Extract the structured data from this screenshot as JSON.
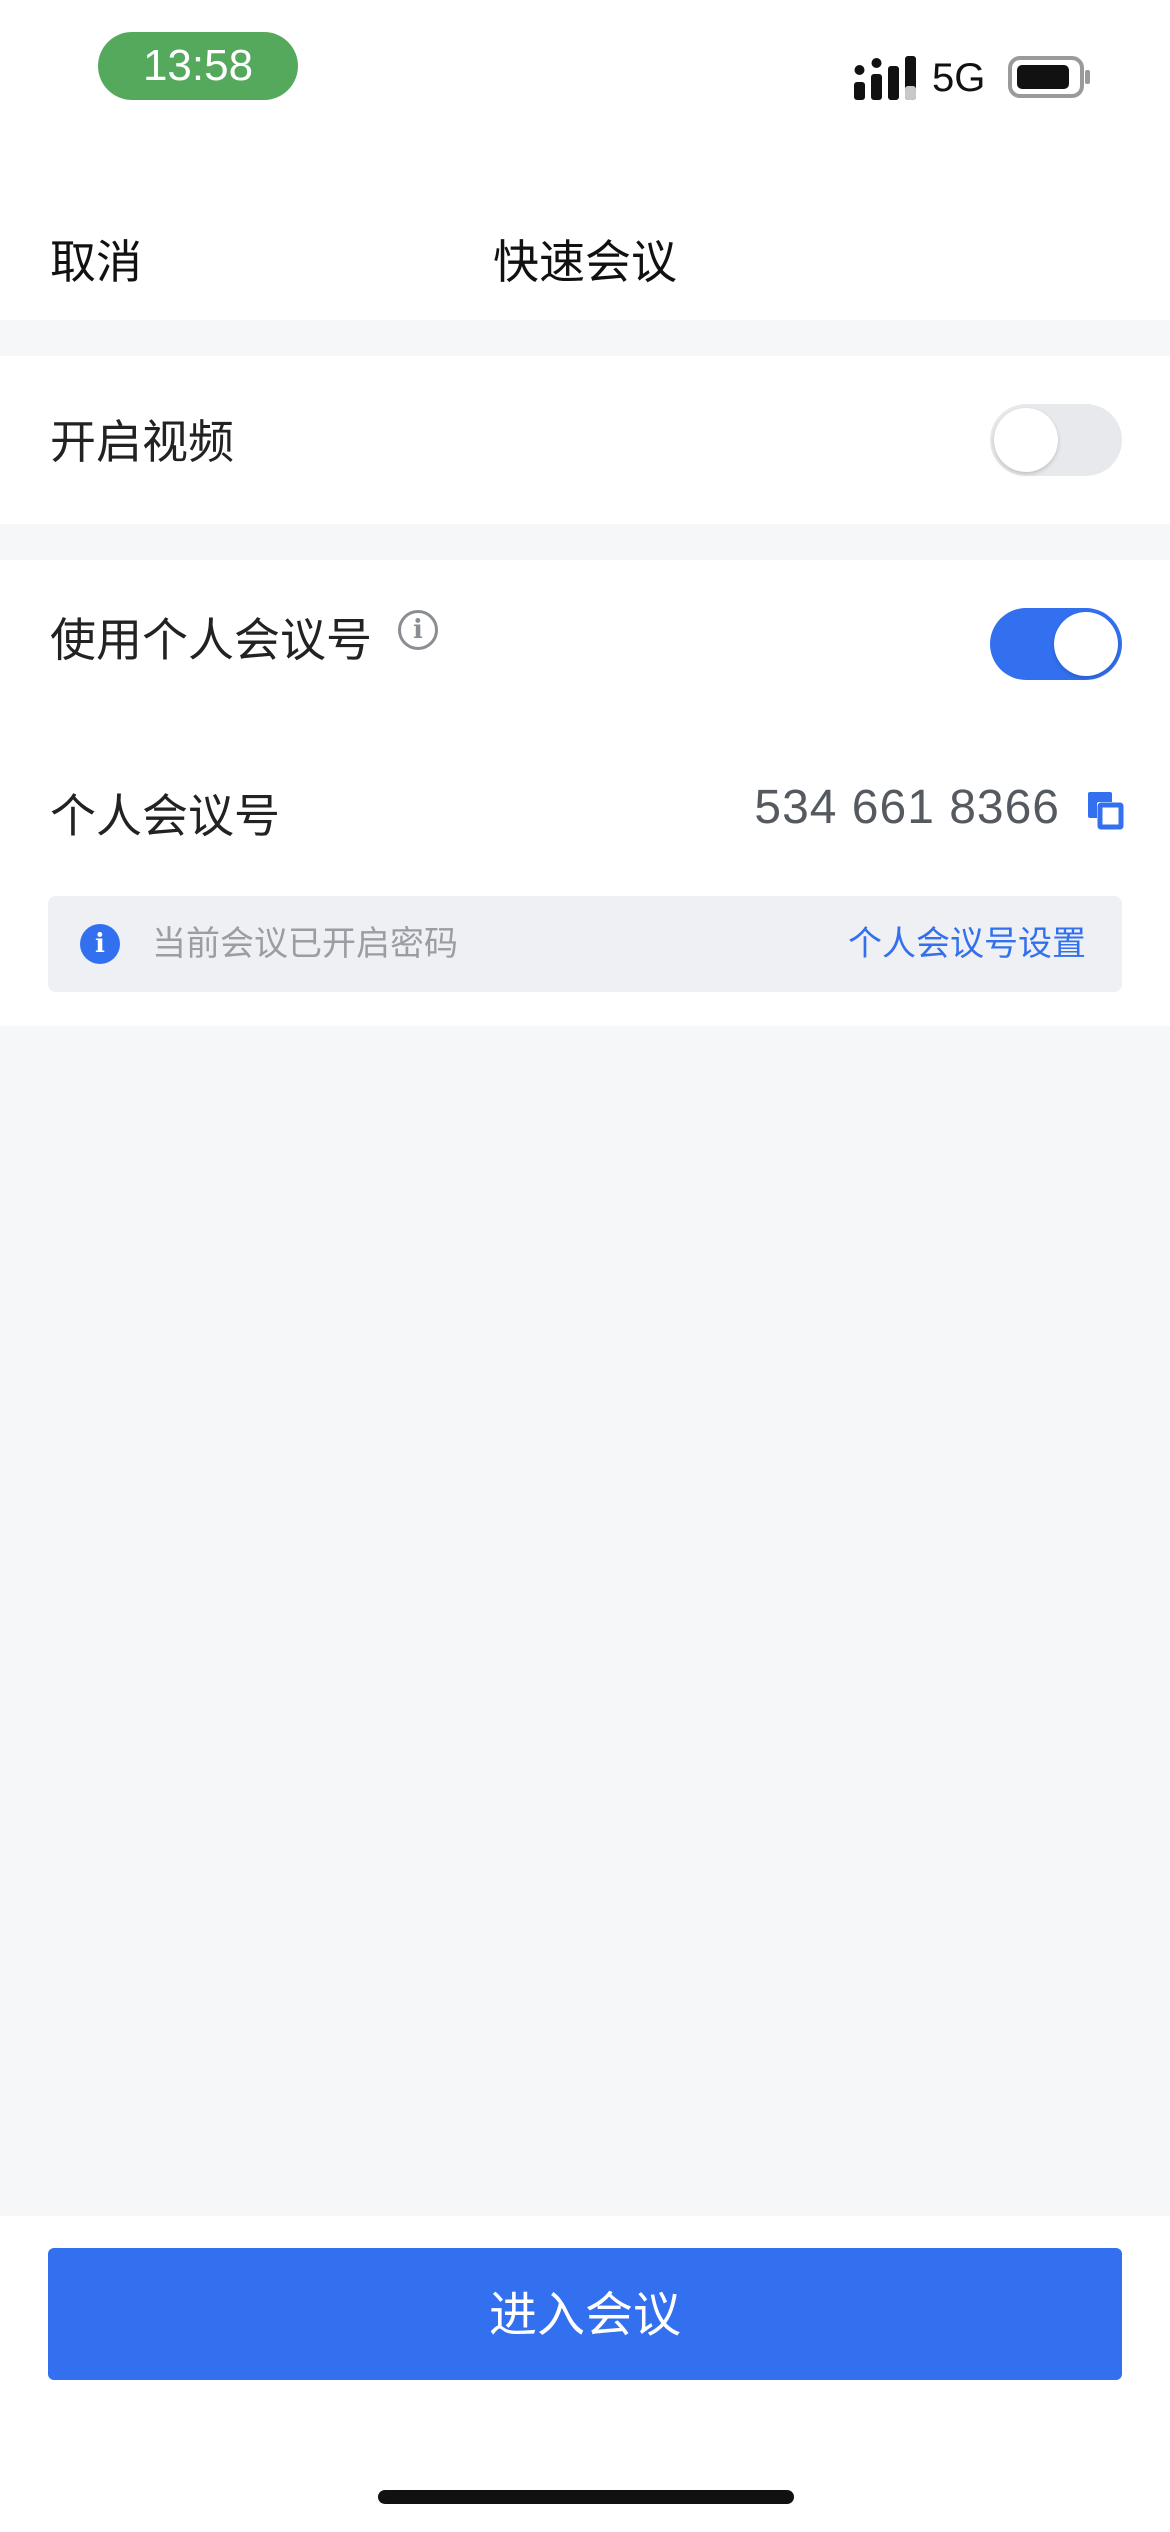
{
  "status_bar": {
    "time": "13:58",
    "network": "5G",
    "icons": [
      "signal-icon",
      "battery-icon"
    ]
  },
  "nav": {
    "cancel_label": "取消",
    "title": "快速会议"
  },
  "video_section": {
    "label": "开启视频",
    "toggle_on": false
  },
  "personal_section": {
    "use_pmi_label": "使用个人会议号",
    "use_pmi_on": true,
    "pmi_label": "个人会议号",
    "pmi_value": "534 661 8366",
    "notice_text": "当前会议已开启密码",
    "notice_link": "个人会议号设置",
    "info_glyph": "i"
  },
  "footer": {
    "enter_label": "进入会议"
  },
  "colors": {
    "accent": "#3370f0",
    "time_pill": "#55a95d",
    "background": "#f6f7f9"
  }
}
